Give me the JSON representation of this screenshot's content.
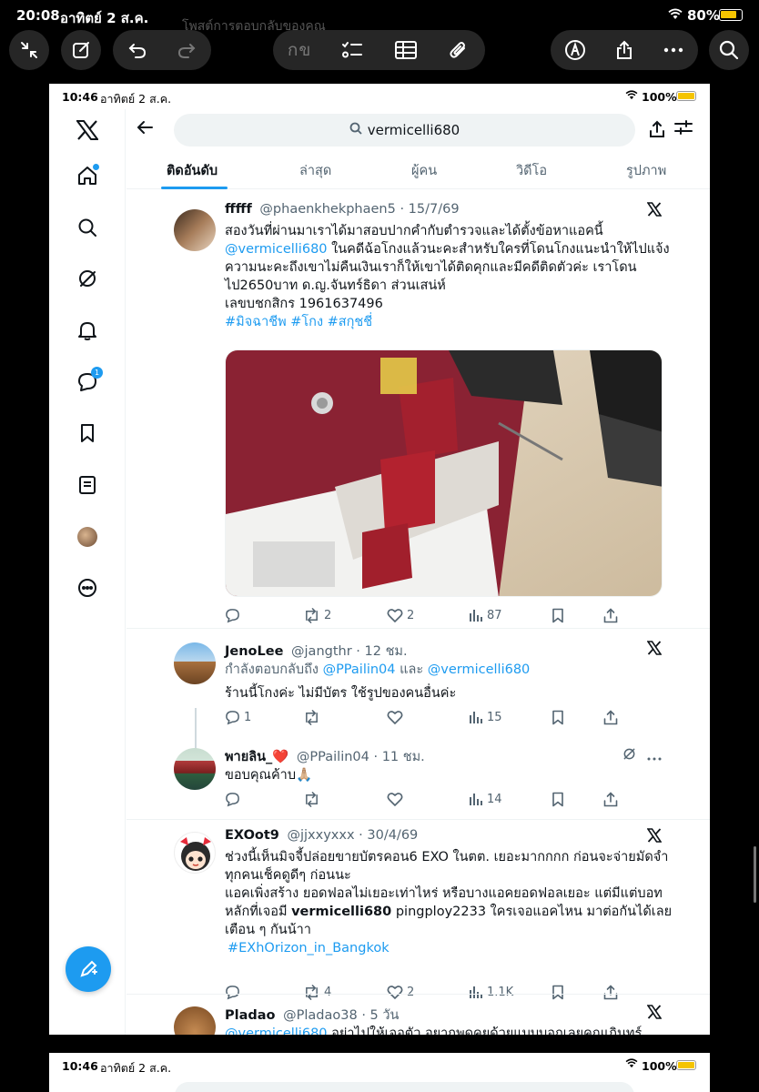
{
  "outer_status": {
    "time": "20:08",
    "date": "อาทิตย์ 2 ส.ค.",
    "battery": "80%",
    "behind_text": "โพสต์การตอบกลับของคุณ"
  },
  "outer_toolbar": {
    "keyboard_label": "กข"
  },
  "ipad_status": {
    "time": "10:46",
    "date": "อาทิตย์ 2 ส.ค.",
    "battery": "100%"
  },
  "search": {
    "query": "vermicelli680"
  },
  "tabs": [
    {
      "label": "ติดอันดับ",
      "active": true
    },
    {
      "label": "ล่าสุด",
      "active": false
    },
    {
      "label": "ผู้คน",
      "active": false
    },
    {
      "label": "วิดีโอ",
      "active": false
    },
    {
      "label": "รูปภาพ",
      "active": false
    }
  ],
  "sidebar": {
    "messages_badge": "1"
  },
  "posts": [
    {
      "name": "fffff",
      "handle": "@phaenkhekphaen5",
      "date": "· 15/7/69",
      "lines": [
        "สองวันที่ผ่านมาเราได้มาสอบปากคำกับตำรวจและได้ตั้งข้อหาแอคนี้",
        "ในคดีฉ้อโกงแล้วนะคะสำหรับใครที่โดนโกงแนะนำให้ไปแจ้ง",
        "ความนะคะถึงเขาไม่คืนเงินเราก็ให้เขาได้ติดคุกและมีคดีติดตัวค่ะ เราโดน",
        "ไป2650บาท ด.ญ.จันทร์ธิดา ส่วนเสน่ห์",
        "เลขบชกสิกร 1961637496"
      ],
      "mention": "@vermicelli680",
      "hashtags": "#มิจฉาชีพ #โกง #สกุชชี่",
      "replies": "",
      "reposts": "2",
      "likes": "2",
      "views": "87"
    },
    {
      "name": "JenoLee",
      "handle": "@jangthr",
      "date": "· 12 ชม.",
      "reply_prefix": "กำลังตอบกลับถึง",
      "reply_to_1": "@PPailin04",
      "reply_and": "และ",
      "reply_to_2": "@vermicelli680",
      "text": "ร้านนี้โกงค่ะ ไม่มีบัตร ใช้รูปของคนอื่นค่ะ",
      "replies": "1",
      "reposts": "",
      "likes": "",
      "views": "15"
    },
    {
      "name": "พายลิน_❤️",
      "handle": "@PPailin04",
      "date": "· 11 ชม.",
      "text": "ขอบคุณค้าบ🙏🏼",
      "replies": "",
      "reposts": "",
      "likes": "",
      "views": "14"
    },
    {
      "name": "EXOot9",
      "handle": "@jjxxyxxx",
      "date": "· 30/4/69",
      "lines": [
        "ช่วงนี้เห็นมิจจี้ปล่อยขายบัตรคอน6 EXO ในตต. เยอะมากกกก ก่อนจะจ่ายมัดจำ",
        "ทุกคนเช็คดูดีๆ ก่อนนะ",
        "แอคเพิ่งสร้าง ยอดฟอลไม่เยอะเท่าไหร่ หรือบางแอคยอดฟอลเยอะ แต่มีแต่บอท"
      ],
      "line4_prefix": "หลักที่เจอมี",
      "line4_bold": "vermicelli680",
      "line4_suffix": "pingploy2233 ใครเจอแอคไหน มาต่อกันได้เลย",
      "line5": "เตือน ๆ กันน้าา",
      "hashtag": "#EXhOrizon_in_Bangkok",
      "replies": "",
      "reposts": "4",
      "likes": "2",
      "views": "1.1K"
    },
    {
      "name": "Pladao",
      "handle": "@Pladao38",
      "date": "· 5 วัน",
      "mention": "@vermicelli680",
      "text": "อย่าไปให้เจอตัว อยากพูดคุยด้วยแบบบอกเลยคุณเกินทร์"
    }
  ],
  "colors": {
    "accent": "#1d9bf0",
    "text": "#0f1419",
    "muted": "#536471"
  }
}
